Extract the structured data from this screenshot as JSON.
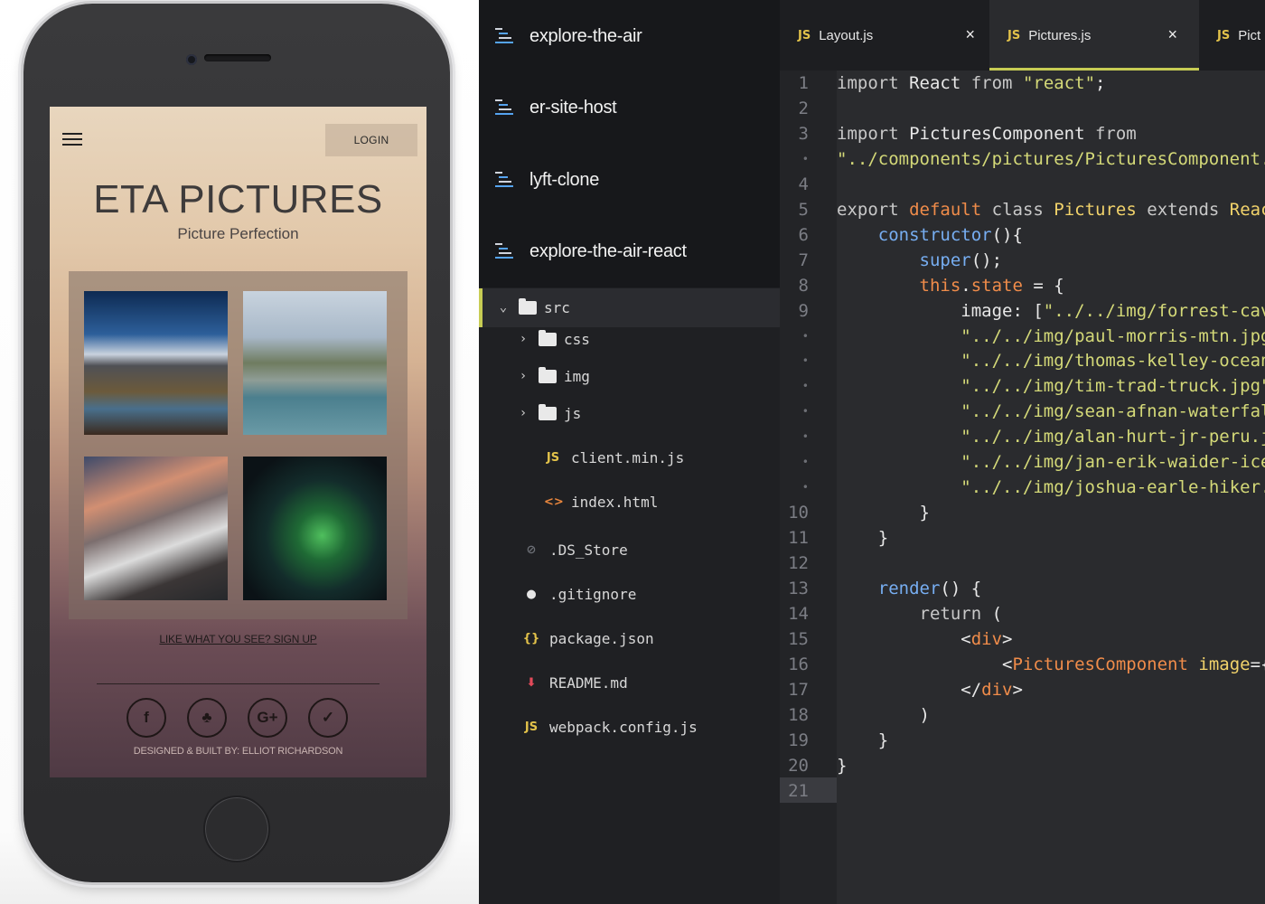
{
  "phone": {
    "login_label": "LOGIN",
    "title": "ETA PICTURES",
    "subtitle": "Picture Perfection",
    "signup_link": "LIKE WHAT YOU SEE? SIGN UP",
    "credit": "DESIGNED & BUILT BY: ELLIOT RICHARDSON",
    "social_icons": [
      "facebook-icon",
      "tree-icon",
      "google-plus-icon",
      "twitter-icon"
    ],
    "social_glyphs": [
      "f",
      "♣",
      "G+",
      "✓"
    ]
  },
  "tree": {
    "projects": [
      "explore-the-air",
      "er-site-host",
      "lyft-clone",
      "explore-the-air-react"
    ],
    "src_label": "src",
    "folders": [
      "css",
      "img",
      "js"
    ],
    "src_files": [
      "client.min.js",
      "index.html"
    ],
    "root_files": [
      ".DS_Store",
      ".gitignore",
      "package.json",
      "README.md",
      "webpack.config.js"
    ],
    "file_glyphs": {
      "js": "JS",
      "html": "<>",
      "ds": "⊘",
      "git": "●",
      "json": "{}",
      "md": "⬇"
    }
  },
  "editor": {
    "tabs": [
      {
        "label": "Layout.js",
        "icon": "JS"
      },
      {
        "label": "Pictures.js",
        "icon": "JS"
      },
      {
        "label": "Pict",
        "icon": "JS"
      }
    ],
    "close_glyph": "×",
    "line_numbers": [
      "1",
      "2",
      "3",
      "•",
      "4",
      "5",
      "6",
      "7",
      "8",
      "9",
      "•",
      "•",
      "•",
      "•",
      "•",
      "•",
      "•",
      "10",
      "11",
      "12",
      "13",
      "14",
      "15",
      "16",
      "17",
      "18",
      "19",
      "20",
      "21"
    ],
    "accent": "#c7cc54"
  }
}
